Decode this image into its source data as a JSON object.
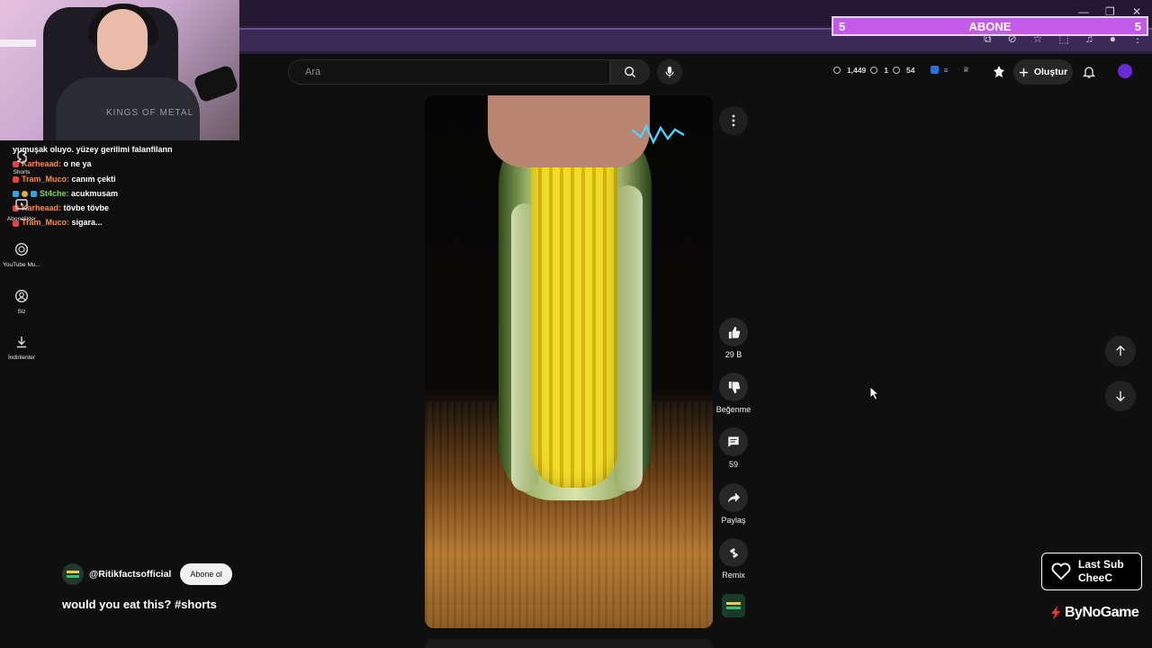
{
  "overlay": {
    "abone_left": "5",
    "abone_label": "ABONE",
    "abone_right": "5",
    "shirt_text": "KINGS OF METAL",
    "last_sub_label": "Last Sub",
    "last_sub_name": "CheeC",
    "brand": "ByNoGame"
  },
  "chat": [
    {
      "user": "",
      "text": "yumuşak oluyo. yüzey gerilimi falanfilann"
    },
    {
      "user": "Karheaad:",
      "text": "o ne ya"
    },
    {
      "user": "Tram_Muco:",
      "text": "canım çekti"
    },
    {
      "user": "St4che:",
      "text": "acukmusam"
    },
    {
      "user": "Karheaad:",
      "text": "tövbe tövbe"
    },
    {
      "user": "Tram_Muco:",
      "text": "sigara..."
    }
  ],
  "sidebar": {
    "items": [
      {
        "label": "Shorts",
        "icon": "shorts-icon"
      },
      {
        "label": "Abonelikler",
        "icon": "subscriptions-icon"
      },
      {
        "label": "YouTube Mu...",
        "icon": "youtube-music-icon"
      },
      {
        "label": "Siz",
        "icon": "profile-icon"
      },
      {
        "label": "İndirilenler",
        "icon": "download-icon"
      }
    ]
  },
  "header": {
    "search_placeholder": "Ara",
    "stats": {
      "views": "1,449",
      "count_a": "1",
      "count_b": "54"
    },
    "create_label": "Oluştur"
  },
  "video": {
    "channel": "@Ritikfactsofficial",
    "subscribe_label": "Abone ol",
    "title": "would you eat this? #shorts"
  },
  "actions": {
    "like_count": "29 B",
    "dislike_label": "Beğenme",
    "comment_count": "59",
    "share_label": "Paylaş",
    "remix_label": "Remix"
  },
  "colors": {
    "abone_bar": "#c35be8",
    "chrome": "#2a1c3a",
    "page_bg": "#0f0f0f",
    "avatar": "#6a2bd6"
  }
}
